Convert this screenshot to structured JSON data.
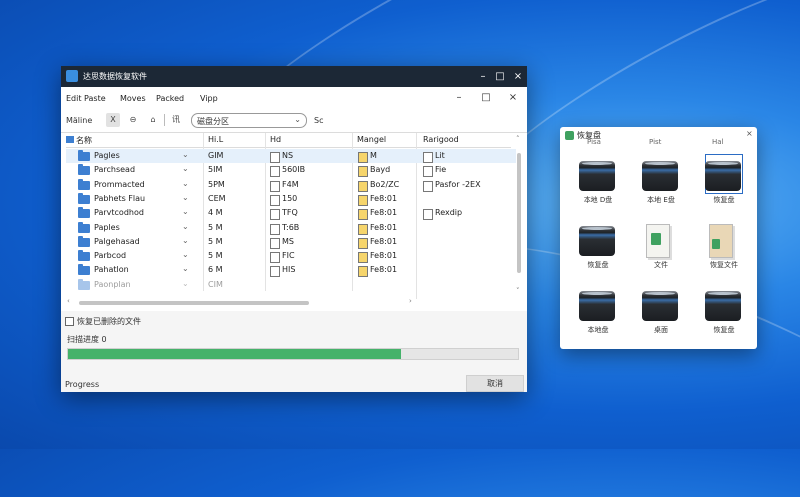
{
  "main_window": {
    "title": "达思数据恢复软件",
    "menu": [
      "Edit Paste",
      "Moves",
      "Packed",
      "Vipp"
    ],
    "toolbar": {
      "label": "Mäline",
      "buttons": [
        "X",
        "⊖",
        "⌂"
      ],
      "mid_label": "讯",
      "combo_value": "磁盘分区",
      "extra_label": "Sc"
    },
    "columns": [
      "名称",
      "Hi.L",
      "Hd",
      "Mangel",
      "Rarigood"
    ],
    "rows": [
      {
        "name": "Pagles",
        "size": "GIM",
        "type": "NS",
        "mod": "M",
        "extra": "Lit",
        "selected": true
      },
      {
        "name": "Parchsead",
        "size": "5IM",
        "type": "560IB",
        "mod": "Bayd",
        "extra": "Fie"
      },
      {
        "name": "Prommacted",
        "size": "5PM",
        "type": "F4M",
        "mod": "Bo2/ZC",
        "extra": "Pasfor -2EX"
      },
      {
        "name": "Pabhets Flau",
        "size": "CEM",
        "type": "150",
        "mod": "Fe8:01",
        "extra": ""
      },
      {
        "name": "Parvtcodhod",
        "size": "4 M",
        "type": "TFQ",
        "mod": "Fe8:01",
        "extra": "Rexdip"
      },
      {
        "name": "Paples",
        "size": "5 M",
        "type": "T:6B",
        "mod": "Fe8:01",
        "extra": ""
      },
      {
        "name": "Palgehasad",
        "size": "5 M",
        "type": "MS",
        "mod": "Fe8:01",
        "extra": ""
      },
      {
        "name": "Parbcod",
        "size": "5 M",
        "type": "FIC",
        "mod": "Fe8:01",
        "extra": ""
      },
      {
        "name": "Pahatlon",
        "size": "6 M",
        "type": "HIS",
        "mod": "Fe8:01",
        "extra": ""
      },
      {
        "name": "Paonplan",
        "size": "CIM",
        "type": "",
        "mod": "",
        "extra": ""
      }
    ],
    "checkbox_label": "恢复已删除的文件",
    "scan_label": "扫描进度 0",
    "progress": 0.74,
    "footer_label": "Progress",
    "footer_button": "取消"
  },
  "side_panel": {
    "title": "恢复盘",
    "tabs": [
      "Pisa",
      "Pist",
      "Hal"
    ],
    "close": "×",
    "tiles": [
      {
        "kind": "drive",
        "label": "本地 D盘",
        "selected": false
      },
      {
        "kind": "drive",
        "label": "本地 E盘",
        "selected": false
      },
      {
        "kind": "drive",
        "label": "恢复盘",
        "selected": true
      },
      {
        "kind": "drive",
        "label": "恢复盘",
        "selected": false
      },
      {
        "kind": "doc",
        "label": "文件",
        "selected": false
      },
      {
        "kind": "box",
        "label": "恢复文件",
        "selected": false
      },
      {
        "kind": "drive",
        "label": "本地盘",
        "selected": false
      },
      {
        "kind": "drive",
        "label": "桌面",
        "selected": false
      },
      {
        "kind": "drive",
        "label": "恢复盘",
        "selected": false
      }
    ]
  },
  "colors": {
    "accent": "#45b26a",
    "titlebar": "#1c2836",
    "desktop": "#1f76db"
  }
}
